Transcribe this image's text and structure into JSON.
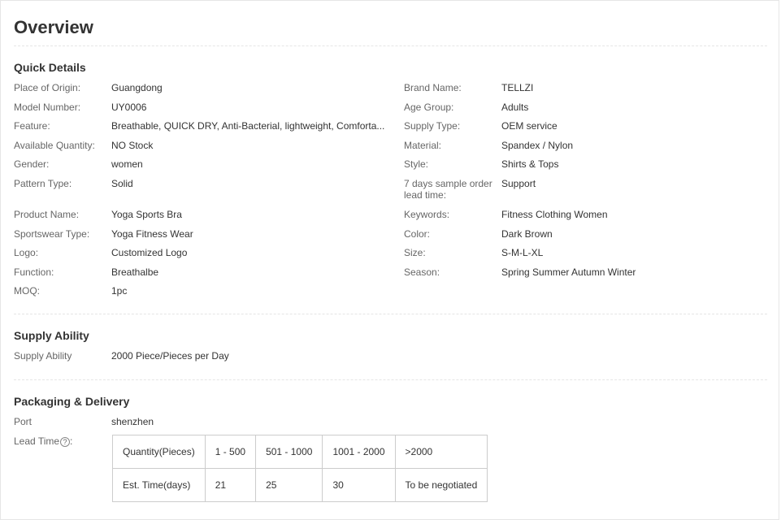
{
  "page": {
    "title": "Overview"
  },
  "quick_details": {
    "title": "Quick Details",
    "left": [
      {
        "label": "Place of Origin:",
        "value": "Guangdong"
      },
      {
        "label": "Model Number:",
        "value": "UY0006"
      },
      {
        "label": "Feature:",
        "value": "Breathable, QUICK DRY, Anti-Bacterial, lightweight, Comforta..."
      },
      {
        "label": "Available Quantity:",
        "value": "NO Stock"
      },
      {
        "label": "Gender:",
        "value": "women"
      },
      {
        "label": "Pattern Type:",
        "value": "Solid"
      },
      {
        "label": "Product Name:",
        "value": "Yoga Sports Bra"
      },
      {
        "label": "Sportswear Type:",
        "value": "Yoga Fitness Wear"
      },
      {
        "label": "Logo:",
        "value": "Customized Logo"
      },
      {
        "label": "Function:",
        "value": "Breathalbe"
      },
      {
        "label": "MOQ:",
        "value": "1pc"
      }
    ],
    "right": [
      {
        "label": "Brand Name:",
        "value": "TELLZI"
      },
      {
        "label": "Age Group:",
        "value": "Adults"
      },
      {
        "label": "Supply Type:",
        "value": "OEM service"
      },
      {
        "label": "Material:",
        "value": "Spandex / Nylon"
      },
      {
        "label": "Style:",
        "value": "Shirts & Tops"
      },
      {
        "label": "7 days sample order lead time:",
        "value": "Support"
      },
      {
        "label": "Keywords:",
        "value": "Fitness Clothing Women"
      },
      {
        "label": "Color:",
        "value": "Dark Brown"
      },
      {
        "label": "Size:",
        "value": "S-M-L-XL"
      },
      {
        "label": "Season:",
        "value": "Spring Summer Autumn Winter"
      }
    ]
  },
  "supply_ability": {
    "title": "Supply Ability",
    "label": "Supply Ability",
    "value": "2000 Piece/Pieces per Day"
  },
  "packaging": {
    "title": "Packaging & Delivery",
    "port_label": "Port",
    "port_value": "shenzhen",
    "lead_time_label": "Lead Time",
    "help_icon": "question-circle-icon",
    "help_glyph": "?",
    "table": {
      "rows": [
        [
          "Quantity(Pieces)",
          "1 - 500",
          "501 - 1000",
          "1001 - 2000",
          ">2000"
        ],
        [
          "Est. Time(days)",
          "21",
          "25",
          "30",
          "To be negotiated"
        ]
      ]
    }
  }
}
